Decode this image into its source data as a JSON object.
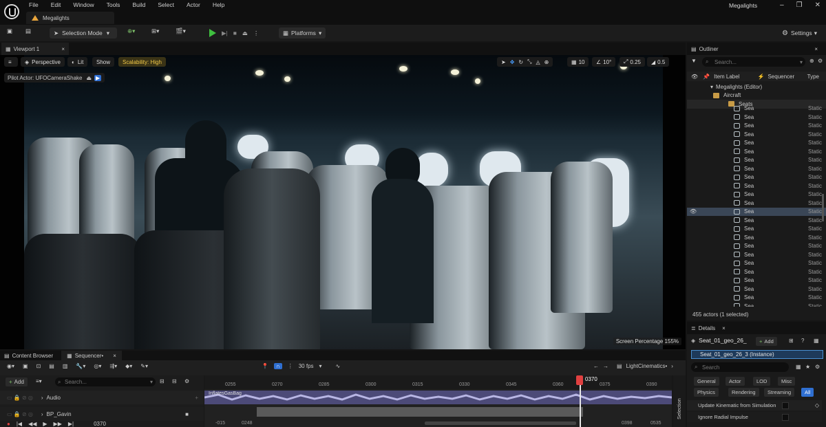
{
  "menubar": {
    "items": [
      "File",
      "Edit",
      "Window",
      "Tools",
      "Build",
      "Select",
      "Actor",
      "Help"
    ],
    "project_tab": "Megalights",
    "window_title": "Megalights"
  },
  "toolbar": {
    "selection_mode": "Selection Mode",
    "platforms": "Platforms",
    "settings": "Settings"
  },
  "viewport": {
    "tab": "Viewport 1",
    "perspective": "Perspective",
    "lit": "Lit",
    "show": "Show",
    "scalability": "Scalability: High",
    "pilot": "Pilot Actor: UFOCameraShake",
    "grid": "10",
    "angle": "10°",
    "scale": "0.25",
    "speed": "0.5",
    "screen_percentage": "Screen Percentage 155%"
  },
  "outliner": {
    "title": "Outliner",
    "search_placeholder": "Search...",
    "col_label": "Item Label",
    "col_sequencer": "Sequencer",
    "col_type": "Type",
    "tree": [
      "Megalights (Editor)",
      "Aircraft",
      "Seats"
    ],
    "item_label": "Sea",
    "item_type": "Static",
    "footer": "455 actors (1 selected)"
  },
  "details": {
    "title": "Details",
    "actor": "Seat_01_geo_26_",
    "add": "Add",
    "instance": "Seat_01_geo_26_3 (Instance)",
    "search_placeholder": "Search",
    "filters": [
      "General",
      "Actor",
      "LOD",
      "Misc",
      "Physics",
      "Rendering",
      "Streaming",
      "All"
    ],
    "props": [
      "Update Kinematic from Simulation",
      "Ignore Radial Impulse"
    ]
  },
  "sequencer": {
    "tab_content": "Content Browser",
    "tab_seq": "Sequencer•",
    "add": "Add",
    "search_placeholder": "Search...",
    "fps": "30 fps",
    "cinematic": "LightCinematics•",
    "tracks": [
      "Audio",
      "BP_Gavin"
    ],
    "audio_clip": "InflatesGasBag",
    "ticks": [
      "0255",
      "0270",
      "0285",
      "0300",
      "0315",
      "0330",
      "0345",
      "0360",
      "0375",
      "0390"
    ],
    "playhead": "0370",
    "frame_current": "0370",
    "frame_start": "-015",
    "frame_in": "0248",
    "frame_out": "0398",
    "frame_end": "0535",
    "selection_label": "Selection"
  }
}
